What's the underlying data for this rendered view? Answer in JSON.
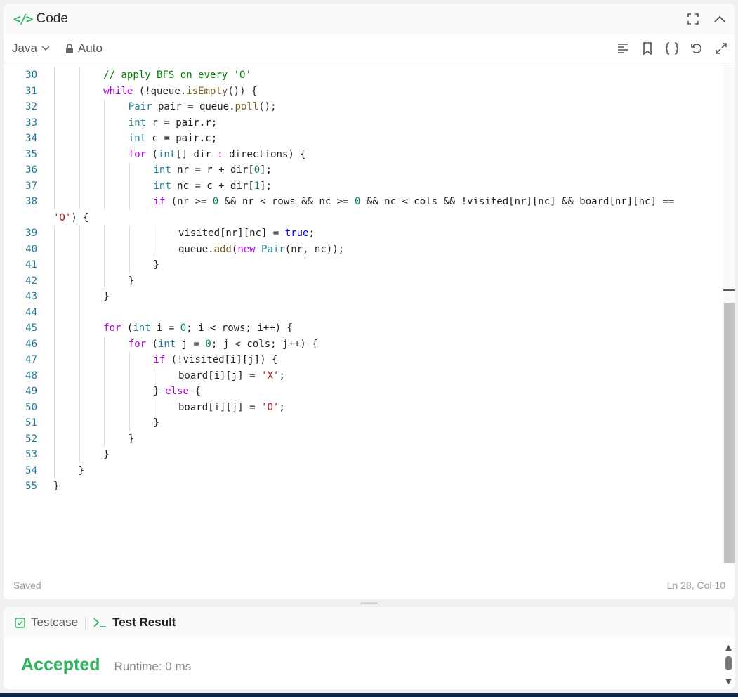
{
  "header": {
    "title": "Code",
    "icon": "code-icon"
  },
  "toolbar": {
    "language": "Java",
    "mode": "Auto"
  },
  "editor": {
    "lines": [
      {
        "n": "30",
        "indent": 2,
        "tokens": [
          [
            "// apply BFS on every 'O'",
            "#008000"
          ]
        ]
      },
      {
        "n": "31",
        "indent": 2,
        "tokens": [
          [
            "while",
            "#af00db"
          ],
          [
            " (!queue.",
            "#1f1f1f"
          ],
          [
            "isEmpty",
            "#795e26"
          ],
          [
            "()) {",
            "#1f1f1f"
          ]
        ]
      },
      {
        "n": "32",
        "indent": 3,
        "tokens": [
          [
            "Pair",
            "#267f99"
          ],
          [
            " pair = queue.",
            "#1f1f1f"
          ],
          [
            "poll",
            "#795e26"
          ],
          [
            "();",
            "#1f1f1f"
          ]
        ]
      },
      {
        "n": "33",
        "indent": 3,
        "tokens": [
          [
            "int",
            "#267f99"
          ],
          [
            " r = pair.r;",
            "#1f1f1f"
          ]
        ]
      },
      {
        "n": "34",
        "indent": 3,
        "tokens": [
          [
            "int",
            "#267f99"
          ],
          [
            " c = pair.c;",
            "#1f1f1f"
          ]
        ]
      },
      {
        "n": "35",
        "indent": 3,
        "tokens": [
          [
            "for",
            "#af00db"
          ],
          [
            " (",
            "#1f1f1f"
          ],
          [
            "int",
            "#267f99"
          ],
          [
            "[] dir ",
            "#1f1f1f"
          ],
          [
            ":",
            "#af00db"
          ],
          [
            " directions) {",
            "#1f1f1f"
          ]
        ]
      },
      {
        "n": "36",
        "indent": 4,
        "tokens": [
          [
            "int",
            "#267f99"
          ],
          [
            " nr = r + dir[",
            "#1f1f1f"
          ],
          [
            "0",
            "#098658"
          ],
          [
            "];",
            "#1f1f1f"
          ]
        ]
      },
      {
        "n": "37",
        "indent": 4,
        "tokens": [
          [
            "int",
            "#267f99"
          ],
          [
            " nc = c + dir[",
            "#1f1f1f"
          ],
          [
            "1",
            "#098658"
          ],
          [
            "];",
            "#1f1f1f"
          ]
        ]
      },
      {
        "n": "38",
        "indent": 4,
        "tokens": [
          [
            "if",
            "#af00db"
          ],
          [
            " (nr >= ",
            "#1f1f1f"
          ],
          [
            "0",
            "#098658"
          ],
          [
            " && nr < rows && nc >= ",
            "#1f1f1f"
          ],
          [
            "0",
            "#098658"
          ],
          [
            " && nc < cols && !visited[nr][nc] && board[nr][nc] ==",
            "#1f1f1f"
          ]
        ]
      },
      {
        "n": "",
        "indent": 0,
        "tokens": [
          [
            "'O'",
            "#a31515"
          ],
          [
            ") {",
            "#1f1f1f"
          ]
        ]
      },
      {
        "n": "39",
        "indent": 5,
        "tokens": [
          [
            "visited[nr][nc] = ",
            "#1f1f1f"
          ],
          [
            "true",
            "#0000ff"
          ],
          [
            ";",
            "#1f1f1f"
          ]
        ]
      },
      {
        "n": "40",
        "indent": 5,
        "tokens": [
          [
            "queue.",
            "#1f1f1f"
          ],
          [
            "add",
            "#795e26"
          ],
          [
            "(",
            "#1f1f1f"
          ],
          [
            "new",
            "#af00db"
          ],
          [
            " ",
            "#1f1f1f"
          ],
          [
            "Pair",
            "#267f99"
          ],
          [
            "(nr, nc));",
            "#1f1f1f"
          ]
        ]
      },
      {
        "n": "41",
        "indent": 4,
        "tokens": [
          [
            "}",
            "#1f1f1f"
          ]
        ]
      },
      {
        "n": "42",
        "indent": 3,
        "tokens": [
          [
            "}",
            "#1f1f1f"
          ]
        ]
      },
      {
        "n": "43",
        "indent": 2,
        "tokens": [
          [
            "}",
            "#1f1f1f"
          ]
        ]
      },
      {
        "n": "44",
        "indent": 2,
        "tokens": []
      },
      {
        "n": "45",
        "indent": 2,
        "tokens": [
          [
            "for",
            "#af00db"
          ],
          [
            " (",
            "#1f1f1f"
          ],
          [
            "int",
            "#267f99"
          ],
          [
            " i = ",
            "#1f1f1f"
          ],
          [
            "0",
            "#098658"
          ],
          [
            "; i < rows; i++) {",
            "#1f1f1f"
          ]
        ]
      },
      {
        "n": "46",
        "indent": 3,
        "tokens": [
          [
            "for",
            "#af00db"
          ],
          [
            " (",
            "#1f1f1f"
          ],
          [
            "int",
            "#267f99"
          ],
          [
            " j = ",
            "#1f1f1f"
          ],
          [
            "0",
            "#098658"
          ],
          [
            "; j < cols; j++) {",
            "#1f1f1f"
          ]
        ]
      },
      {
        "n": "47",
        "indent": 4,
        "tokens": [
          [
            "if",
            "#af00db"
          ],
          [
            " (!visited[i][j]) {",
            "#1f1f1f"
          ]
        ]
      },
      {
        "n": "48",
        "indent": 5,
        "tokens": [
          [
            "board[i][j] = ",
            "#1f1f1f"
          ],
          [
            "'X'",
            "#a31515"
          ],
          [
            ";",
            "#1f1f1f"
          ]
        ]
      },
      {
        "n": "49",
        "indent": 4,
        "tokens": [
          [
            "} ",
            "#1f1f1f"
          ],
          [
            "else",
            "#af00db"
          ],
          [
            " {",
            "#1f1f1f"
          ]
        ]
      },
      {
        "n": "50",
        "indent": 5,
        "tokens": [
          [
            "board[i][j] = ",
            "#1f1f1f"
          ],
          [
            "'O'",
            "#a31515"
          ],
          [
            ";",
            "#1f1f1f"
          ]
        ]
      },
      {
        "n": "51",
        "indent": 4,
        "tokens": [
          [
            "}",
            "#1f1f1f"
          ]
        ]
      },
      {
        "n": "52",
        "indent": 3,
        "tokens": [
          [
            "}",
            "#1f1f1f"
          ]
        ]
      },
      {
        "n": "53",
        "indent": 2,
        "tokens": [
          [
            "}",
            "#1f1f1f"
          ]
        ]
      },
      {
        "n": "54",
        "indent": 1,
        "tokens": [
          [
            "}",
            "#1f1f1f"
          ]
        ]
      },
      {
        "n": "55",
        "indent": 0,
        "tokens": [
          [
            "}",
            "#1f1f1f"
          ]
        ]
      }
    ]
  },
  "status": {
    "saved": "Saved",
    "cursor": "Ln 28, Col 10"
  },
  "bottom": {
    "tabs": [
      {
        "label": "Testcase"
      },
      {
        "label": "Test Result"
      }
    ],
    "result": "Accepted",
    "runtime": "Runtime: 0 ms"
  },
  "colors": {
    "accent": "#2db55d",
    "line_number": "#227893"
  }
}
